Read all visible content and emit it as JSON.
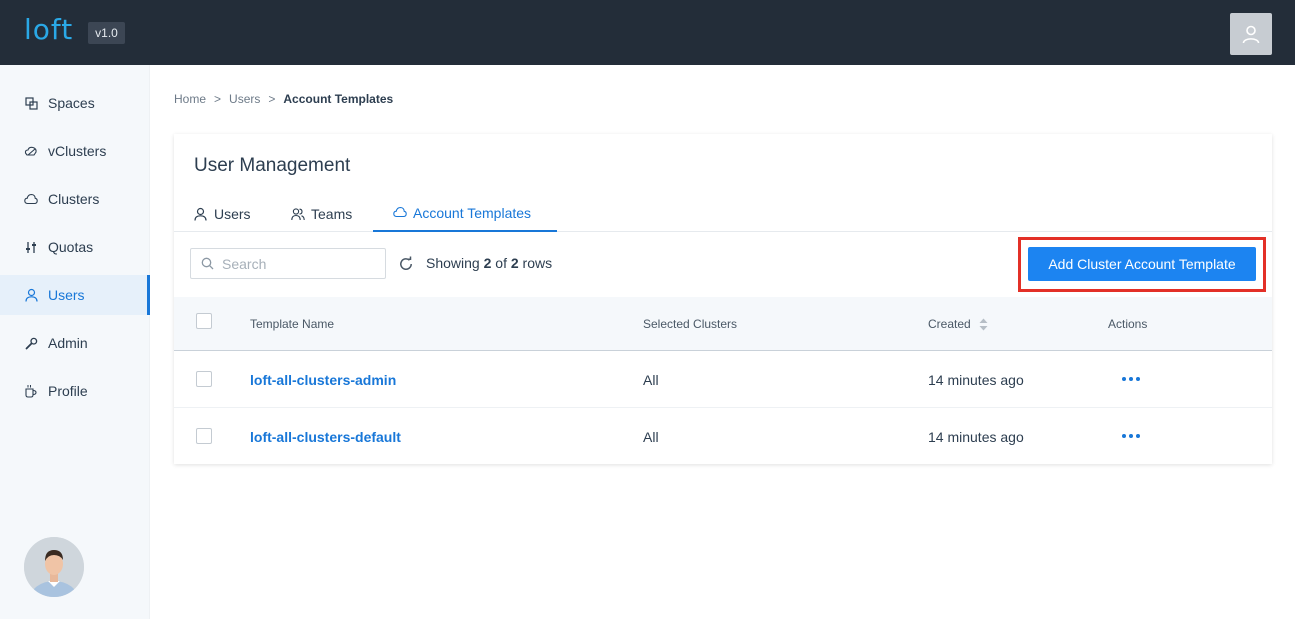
{
  "header": {
    "logo_text": "loft",
    "version": "v1.0"
  },
  "sidebar": {
    "items": [
      {
        "label": "Spaces",
        "icon": "spaces-icon"
      },
      {
        "label": "vClusters",
        "icon": "vclusters-icon"
      },
      {
        "label": "Clusters",
        "icon": "cloud-icon"
      },
      {
        "label": "Quotas",
        "icon": "sliders-icon"
      },
      {
        "label": "Users",
        "icon": "user-icon",
        "active": true
      },
      {
        "label": "Admin",
        "icon": "wrench-icon"
      },
      {
        "label": "Profile",
        "icon": "coffee-icon"
      }
    ]
  },
  "breadcrumb": {
    "items": [
      "Home",
      "Users",
      "Account Templates"
    ],
    "separator": ">"
  },
  "card": {
    "title": "User Management",
    "tabs": [
      {
        "label": "Users",
        "icon": "user-icon"
      },
      {
        "label": "Teams",
        "icon": "team-icon"
      },
      {
        "label": "Account Templates",
        "icon": "cloud-icon",
        "active": true
      }
    ]
  },
  "toolbar": {
    "search_placeholder": "Search",
    "showing_prefix": "Showing",
    "showing_count": "2",
    "showing_of": "of",
    "showing_total": "2",
    "showing_suffix": "rows",
    "add_button_label": "Add Cluster Account Template"
  },
  "table": {
    "columns": [
      "Template Name",
      "Selected Clusters",
      "Created",
      "Actions"
    ],
    "rows": [
      {
        "name": "loft-all-clusters-admin",
        "clusters": "All",
        "created": "14 minutes ago"
      },
      {
        "name": "loft-all-clusters-default",
        "clusters": "All",
        "created": "14 minutes ago"
      }
    ]
  },
  "colors": {
    "topbar": "#232d39",
    "accent": "#1877d8",
    "button": "#1c84f1",
    "highlight": "#e33027"
  }
}
